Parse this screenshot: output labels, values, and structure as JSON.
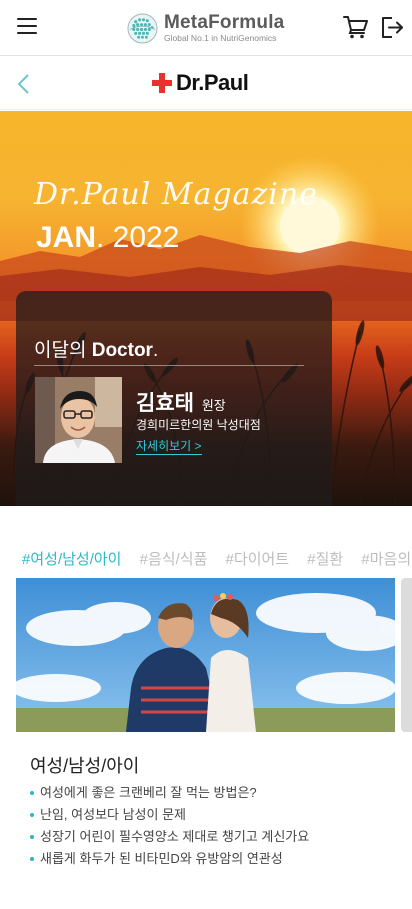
{
  "header": {
    "brand_name": "MetaFormula",
    "brand_tagline": "Global No.1 in NutriGenomics",
    "icons": [
      "menu-icon",
      "globe-logo-icon",
      "cart-icon",
      "logout-icon"
    ]
  },
  "subheader": {
    "logo_text": "Dr.Paul",
    "icons": [
      "back-chevron-icon",
      "red-cross-icon"
    ]
  },
  "hero": {
    "magazine_title": "Dr.Paul Magazine",
    "month": "JAN",
    "year": ". 2022",
    "doctor_heading_prefix": "이달의 ",
    "doctor_heading_bold": "Doctor",
    "doctor_heading_suffix": ".",
    "doctor_name": "김효태",
    "doctor_role": "원장",
    "doctor_clinic": "경희미르한의원 낙성대점",
    "more_link": "자세히보기 >"
  },
  "tabs": [
    {
      "label": "#여성/남성/아이",
      "active": true
    },
    {
      "label": "#음식/식품",
      "active": false
    },
    {
      "label": "#다이어트",
      "active": false
    },
    {
      "label": "#질환",
      "active": false
    },
    {
      "label": "#마음의",
      "active": false
    }
  ],
  "card": {
    "title": "여성/남성/아이",
    "items": [
      "여성에게 좋은 크랜베리 잘 먹는 방법은?",
      "난임, 여성보다 남성이 문제",
      "성장기 어린이 필수영양소 제대로 챙기고 계신가요",
      "새롭게 화두가 된 비타민D와 유방암의 연관성"
    ]
  },
  "colors": {
    "accent": "#2db8c9",
    "brand_red": "#e8322e",
    "tab_inactive": "#bdbdbd"
  }
}
